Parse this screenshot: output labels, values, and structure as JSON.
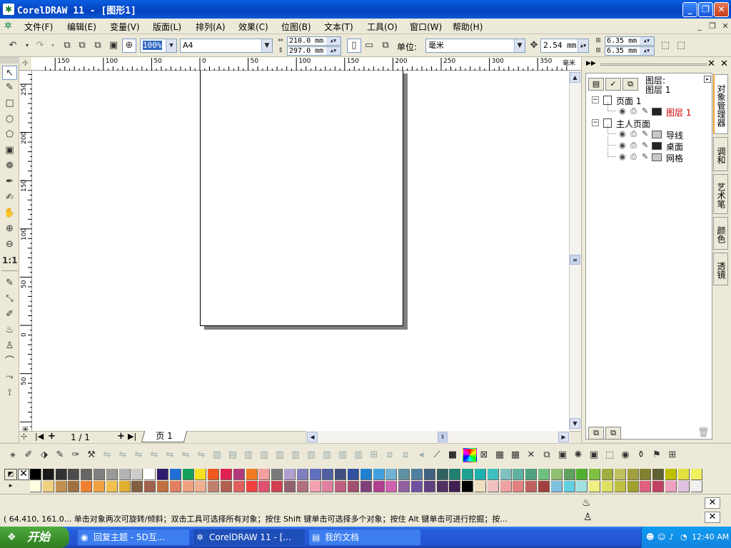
{
  "window": {
    "title": "CorelDRAW 11 - [图形1]",
    "app_icon": "coreldraw-balloon-icon",
    "controls": {
      "minimize": "_",
      "restore": "❐",
      "close": "✕"
    }
  },
  "menubar": {
    "items": [
      {
        "label": "文件(F)"
      },
      {
        "label": "编辑(E)"
      },
      {
        "label": "变量(V)"
      },
      {
        "label": "版面(L)"
      },
      {
        "label": "排列(A)"
      },
      {
        "label": "效果(C)"
      },
      {
        "label": "位图(B)"
      },
      {
        "label": "文本(T)"
      },
      {
        "label": "工具(O)"
      },
      {
        "label": "窗口(W)"
      },
      {
        "label": "帮助(H)"
      }
    ],
    "doc_controls": {
      "minimize": "_",
      "restore": "❐",
      "close": "✕"
    }
  },
  "propbar": {
    "zoom": "100%",
    "paper": "A4",
    "width": "210.0 mm",
    "height": "297.0 mm",
    "units_label": "单位:",
    "units": "毫米",
    "nudge": "2.54 mm",
    "dup_x": "6.35 mm",
    "dup_y": "6.35 mm"
  },
  "ruler": {
    "h_labels": [
      "150",
      "100",
      "50",
      "0",
      "50",
      "100",
      "150",
      "200",
      "250",
      "300",
      "350"
    ],
    "unit": "毫米",
    "v_labels": [
      "250",
      "200",
      "150",
      "100",
      "50",
      "0",
      "50"
    ],
    "v_unit": "毫米"
  },
  "document": {
    "page_indicator": "1 / 1",
    "page_tab": "页 1"
  },
  "docker": {
    "header_layer_label": "图层:",
    "header_layer_value": "图层 1",
    "tree": [
      {
        "label": "页面 1",
        "level": 0
      },
      {
        "label": "图层 1",
        "level": 1,
        "color": "#222222",
        "highlight": true
      },
      {
        "label": "主人页面",
        "level": 0
      },
      {
        "label": "导线",
        "level": 1,
        "color": "#c8c8c8"
      },
      {
        "label": "桌面",
        "level": 1,
        "color": "#222222"
      },
      {
        "label": "网格",
        "level": 1,
        "color": "#c8c8c8"
      }
    ],
    "side_tabs": [
      "对象管理器",
      "调和",
      "艺术笔",
      "颜色",
      "透镜"
    ]
  },
  "status": {
    "line1": "( 64.410, 161.0... 单击对象两次可旋转/倾斜；双击工具可选择所有对象；按住 Shift 键单击可选择多个对象；按住 Alt 键单击可进行挖掘；按..."
  },
  "taskbar": {
    "start": "开始",
    "tasks": [
      {
        "label": "回复主题 - 5D互..."
      },
      {
        "label": "CorelDRAW 11 - [..."
      },
      {
        "label": "我的文档"
      }
    ],
    "clock": "12:40 AM"
  },
  "colors": {
    "title_blue": "#0441c0",
    "taskbar_blue": "#245edc",
    "start_green": "#3b8f2c",
    "layer_highlight": "#cc0000"
  }
}
